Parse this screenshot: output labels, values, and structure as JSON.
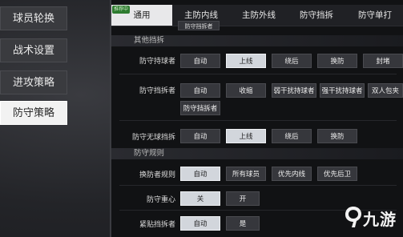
{
  "left_menu": [
    {
      "label": "球员轮换",
      "active": false
    },
    {
      "label": "战术设置",
      "active": false
    },
    {
      "label": "进攻策略",
      "active": false
    },
    {
      "label": "防守策略",
      "active": true
    }
  ],
  "tabs": [
    {
      "label": "通用",
      "active": true,
      "badge": "推荐中"
    },
    {
      "label": "主防内线",
      "active": false
    },
    {
      "label": "主防外线",
      "active": false
    },
    {
      "label": "防守挡拆",
      "active": false
    },
    {
      "label": "防守单打",
      "active": false
    }
  ],
  "top_partial_button": "防守挡拆者",
  "sections": {
    "other_pick": "其他挡拆",
    "defense_rules": "防守规则"
  },
  "rows": {
    "ball_handler": {
      "label": "防守持球者",
      "options": [
        "自动",
        "上线",
        "绕后",
        "换防",
        "封堵"
      ],
      "selected": "上线"
    },
    "screener": {
      "label": "防守挡拆者",
      "options": [
        "自动",
        "收缩",
        "弱干扰持球者",
        "强干扰持球者",
        "双人包夹",
        "防守挡拆者"
      ],
      "selected": ""
    },
    "off_ball_pick": {
      "label": "防守无球挡拆",
      "options": [
        "自动",
        "上线",
        "绕后",
        "换防"
      ],
      "selected": "上线"
    },
    "switch_rules": {
      "label": "换防者规则",
      "options": [
        "自动",
        "所有球员",
        "优先内线",
        "优先后卫"
      ],
      "selected": "自动"
    },
    "defense_center": {
      "label": "防守重心",
      "options": [
        "关",
        "开"
      ],
      "selected": "关"
    },
    "tight_screener": {
      "label": "紧贴挡拆者",
      "options": [
        "自动",
        "是"
      ],
      "selected": "自动"
    }
  },
  "watermark": {
    "text": "九游"
  }
}
